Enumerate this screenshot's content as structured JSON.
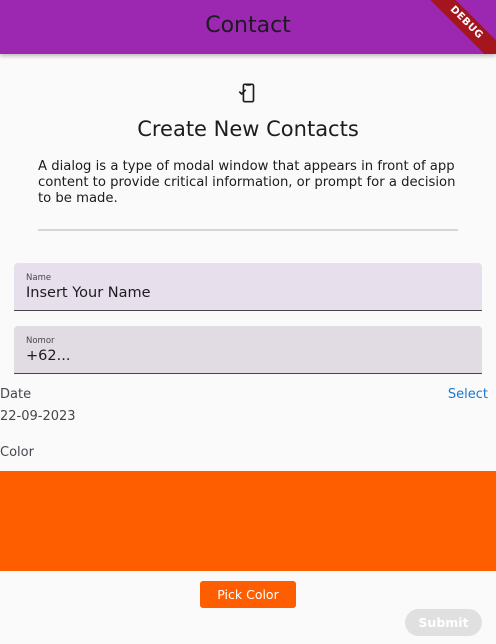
{
  "appbar": {
    "title": "Contact",
    "debug_label": "DEBUG"
  },
  "header": {
    "icon": "phone-check-icon",
    "title": "Create New Contacts",
    "description": "A dialog is a type of modal window that appears in front of app content to provide critical information, or prompt for a decision to be made."
  },
  "form": {
    "name_field": {
      "label": "Name",
      "value": "Insert Your Name"
    },
    "number_field": {
      "label": "Nomor",
      "value": "+62..."
    },
    "date": {
      "label": "Date",
      "select_label": "Select",
      "value": "22-09-2023"
    },
    "color": {
      "label": "Color",
      "value": "#ff5e00",
      "pick_label": "Pick Color"
    },
    "submit_label": "Submit"
  },
  "colors": {
    "appbar": "#9c27b0",
    "accent": "#ff5e00",
    "link": "#1976d2"
  }
}
